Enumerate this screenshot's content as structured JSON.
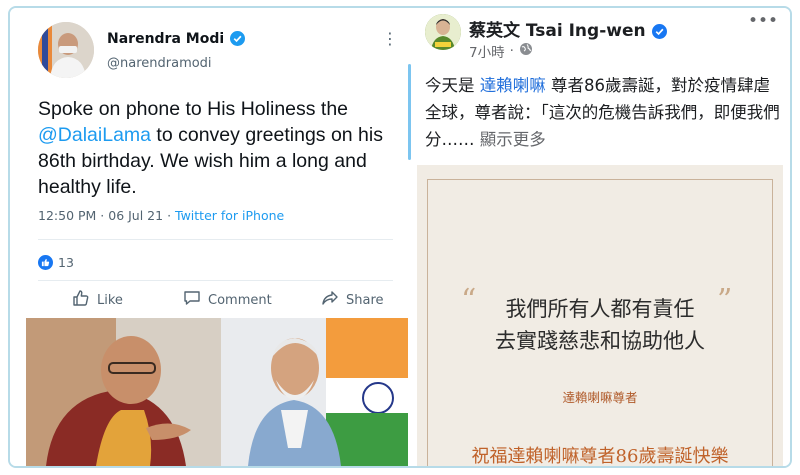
{
  "twitter": {
    "name": "Narendra Modi",
    "handle": "@narendramodi",
    "text_before": "Spoke on phone to His Holiness the ",
    "mention": "@DalaiLama",
    "text_after": " to convey greetings on his 86th birthday. We wish him a long and healthy life.",
    "time": "12:50 PM · 06 Jul 21",
    "separator": " · ",
    "source": "Twitter for iPhone",
    "like_count": "13",
    "actions": {
      "like": "Like",
      "comment": "Comment",
      "share": "Share"
    },
    "colors": {
      "link": "#1d9bf0",
      "verified": "#1d9bf0"
    }
  },
  "facebook": {
    "name": "蔡英文 Tsai Ing-wen",
    "time": "7小時",
    "separator": "·",
    "text_before": "今天是 ",
    "link": "達賴喇嘛",
    "text_after": " 尊者86歲壽誕，對於疫情肆虐全球，尊者說：「這次的危機告訴我們，即便我們分……",
    "see_more": " 顯示更多",
    "card": {
      "open_quote": "“",
      "close_quote": "”",
      "line1": "我們所有人都有責任",
      "line2": "去實踐慈悲和協助他人",
      "author": "達賴喇嘛尊者",
      "bless": "祝福達賴喇嘛尊者86歲壽誕快樂"
    },
    "colors": {
      "link": "#216fdb",
      "card_bg": "#f1ece4",
      "accent": "#c0622a"
    }
  }
}
